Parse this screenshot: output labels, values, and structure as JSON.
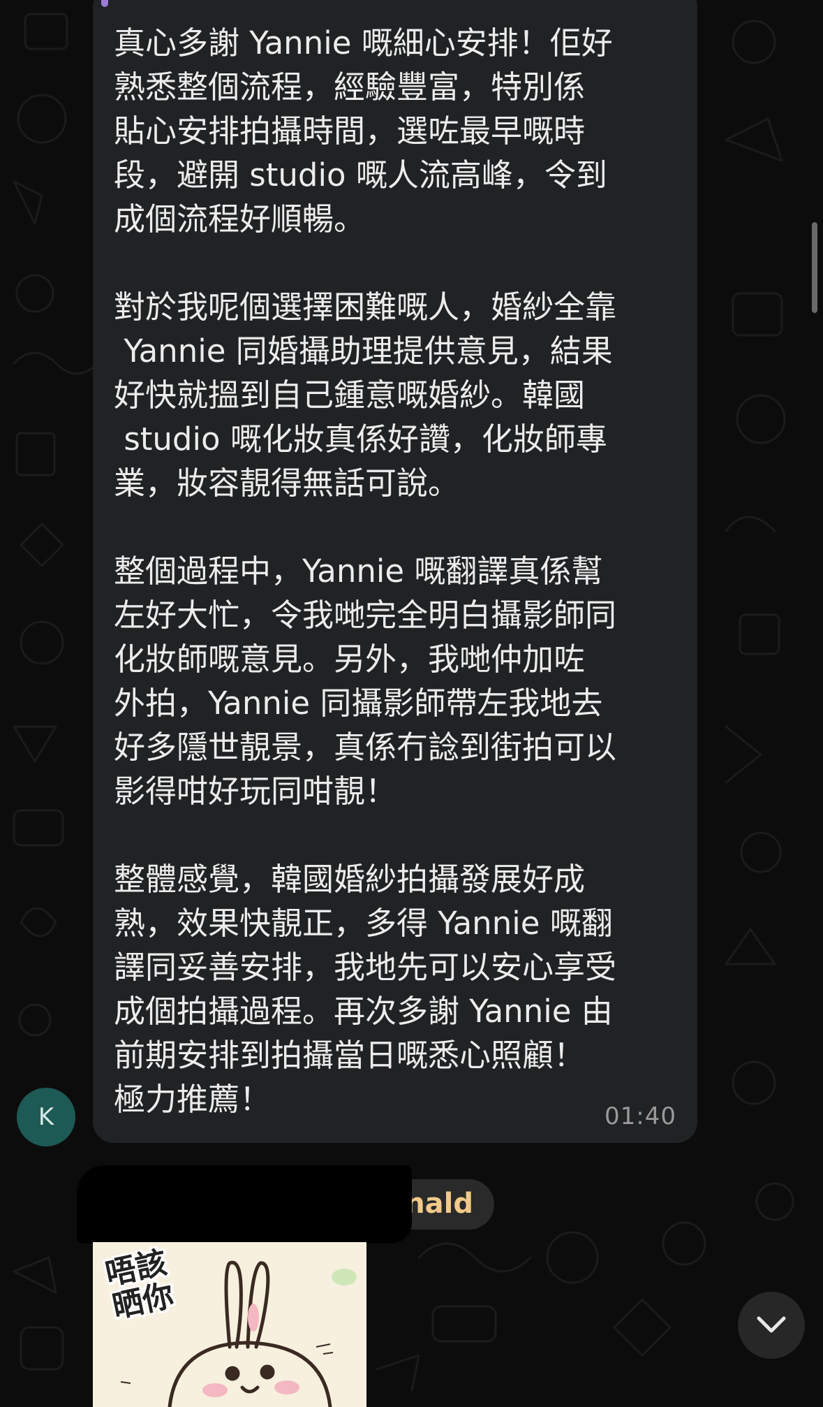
{
  "message": {
    "paragraphs": [
      "真心多謝 Yannie 嘅細心安排！佢好熟悉整個流程，經驗豐富，特別係貼心安排拍攝時間，選咗最早嘅時段，避開 studio 嘅人流高峰，令到成個流程好順暢。",
      "對於我呢個選擇困難嘅人，婚紗全靠 Yannie 同婚攝助理提供意見，結果好快就搵到自己鍾意嘅婚紗。韓國 studio 嘅化妝真係好讚，化妝師專業，妝容靚得無話可說。",
      "整個過程中，Yannie 嘅翻譯真係幫左好大忙，令我哋完全明白攝影師同化妝師嘅意見。另外，我哋仲加咗外拍，Yannie 同攝影師帶左我地去好多隱世靚景，真係冇諗到街拍可以影得咁好玩同咁靚！",
      "整體感覺，韓國婚紗拍攝發展好成熟，效果快靚正，多得 Yannie 嘅翻譯同妥善安排，我地先可以安心享受成個拍攝過程。再次多謝 Yannie 由前期安排到拍攝當日嘅悉心照顧！極力推薦！"
    ],
    "lines": [
      "真心多謝 Yannie 嘅細心安排！佢好",
      "熟悉整個流程，經驗豐富，特別係",
      "貼心安排拍攝時間，選咗最早嘅時",
      "段，避開 studio 嘅人流高峰，令到",
      "成個流程好順暢。",
      "",
      "對於我呢個選擇困難嘅人，婚紗全靠",
      " Yannie 同婚攝助理提供意見，結果",
      "好快就搵到自己鍾意嘅婚紗。韓國",
      " studio 嘅化妝真係好讚，化妝師專",
      "業，妝容靚得無話可說。",
      "",
      "整個過程中，Yannie 嘅翻譯真係幫",
      "左好大忙，令我哋完全明白攝影師同",
      "化妝師嘅意見。另外，我哋仲加咗",
      "外拍，Yannie 同攝影師帶左我地去",
      "好多隱世靚景，真係冇諗到街拍可以",
      "影得咁好玩同咁靚！",
      "",
      "整體感覺，韓國婚紗拍攝發展好成",
      "熟，效果快靚正，多得 Yannie 嘅翻",
      "譯同妥善安排，我地先可以安心享受",
      "成個拍攝過程。再次多謝 Yannie 由",
      "前期安排到拍攝當日嘅悉心照顧！",
      "極力推薦！"
    ],
    "time": "01:40"
  },
  "avatar": {
    "initial": "K",
    "color": "#1e5a55"
  },
  "next_sender": {
    "name_visible": "nald"
  },
  "sticker": {
    "text": "唔該\n晒你"
  },
  "scroll_button": {
    "icon": "chevron-down-icon"
  },
  "colors": {
    "bubble": "#202224",
    "background": "#0c0c0c",
    "sender_name": "#f3c98a",
    "reply_accent": "#9b7ad8"
  }
}
